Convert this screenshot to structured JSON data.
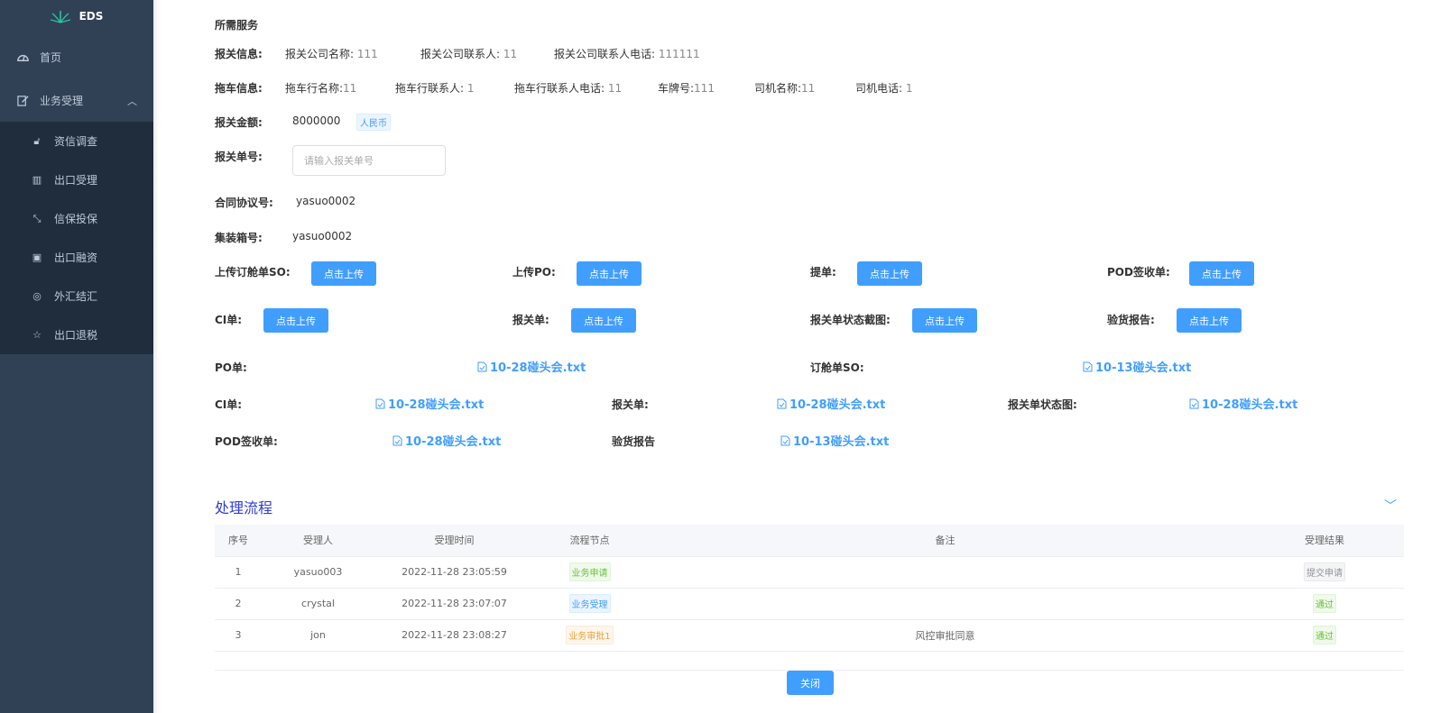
{
  "app": {
    "logo_text": "EDS"
  },
  "sidebar": {
    "home": "首页",
    "business": "业务受理",
    "sub_items": [
      "资信调查",
      "出口受理",
      "信保投保",
      "出口融资",
      "外汇结汇",
      "出口退税"
    ]
  },
  "content": {
    "required_services": "所需服务",
    "customs_info": {
      "label": "报关信息:",
      "company_name_label": "报关公司名称:",
      "company_name": "111",
      "contact_label": "报关公司联系人:",
      "contact": "11",
      "phone_label": "报关公司联系人电话:",
      "phone": "111111"
    },
    "trailer_info": {
      "label": "拖车信息:",
      "company_label": "拖车行名称:",
      "company": "11",
      "contact_label": "拖车行联系人:",
      "contact": "1",
      "phone_label": "拖车行联系人电话:",
      "phone": "11",
      "plate_label": "车牌号:",
      "plate": "111",
      "driver_label": "司机名称:",
      "driver": "11",
      "driver_phone_label": "司机电话:",
      "driver_phone": "1"
    },
    "amount": {
      "label": "报关金额:",
      "value": "8000000",
      "currency": "人民币"
    },
    "customs_no": {
      "label": "报关单号:",
      "placeholder": "请输入报关单号"
    },
    "contract": {
      "label": "合同协议号:",
      "value": "yasuo0002"
    },
    "container": {
      "label": "集装箱号:",
      "value": "yasuo0002"
    },
    "uploads_row1": [
      {
        "label": "上传订舱单SO:",
        "button": "点击上传"
      },
      {
        "label": "上传PO:",
        "button": "点击上传"
      },
      {
        "label": "提单:",
        "button": "点击上传"
      },
      {
        "label": "POD签收单:",
        "button": "点击上传"
      }
    ],
    "uploads_row2": [
      {
        "label": "CI单:",
        "button": "点击上传"
      },
      {
        "label": "报关单:",
        "button": "点击上传"
      },
      {
        "label": "报关单状态截图:",
        "button": "点击上传"
      },
      {
        "label": "验货报告:",
        "button": "点击上传"
      }
    ],
    "files_row1": [
      {
        "label": "PO单:",
        "file": "10-28碰头会.txt"
      },
      {
        "label": "订舱单SO:",
        "file": "10-13碰头会.txt"
      }
    ],
    "files_row2": [
      {
        "label": "CI单:",
        "file": "10-28碰头会.txt"
      },
      {
        "label": "报关单:",
        "file": "10-28碰头会.txt"
      },
      {
        "label": "报关单状态图:",
        "file": "10-28碰头会.txt"
      }
    ],
    "files_row3": [
      {
        "label": "POD签收单:",
        "file": "10-28碰头会.txt"
      },
      {
        "label": "验货报告",
        "file": "10-13碰头会.txt"
      }
    ]
  },
  "process": {
    "title": "处理流程",
    "columns": [
      "序号",
      "受理人",
      "受理时间",
      "流程节点",
      "备注",
      "受理结果"
    ],
    "rows": [
      {
        "no": "1",
        "handler": "yasuo003",
        "time": "2022-11-28 23:05:59",
        "node": "业务申请",
        "remark": "",
        "result": "提交申请"
      },
      {
        "no": "2",
        "handler": "crystal",
        "time": "2022-11-28 23:07:07",
        "node": "业务受理",
        "remark": "",
        "result": "通过"
      },
      {
        "no": "3",
        "handler": "jon",
        "time": "2022-11-28 23:08:27",
        "node": "业务审批1",
        "remark": "风控审批同意",
        "result": "通过"
      }
    ]
  },
  "footer": {
    "close": "关闭"
  },
  "colors": {
    "sidebar_bg": "#304156",
    "submenu_bg": "#1f2d3d",
    "primary": "#409eff",
    "title": "#2f3bd6"
  }
}
